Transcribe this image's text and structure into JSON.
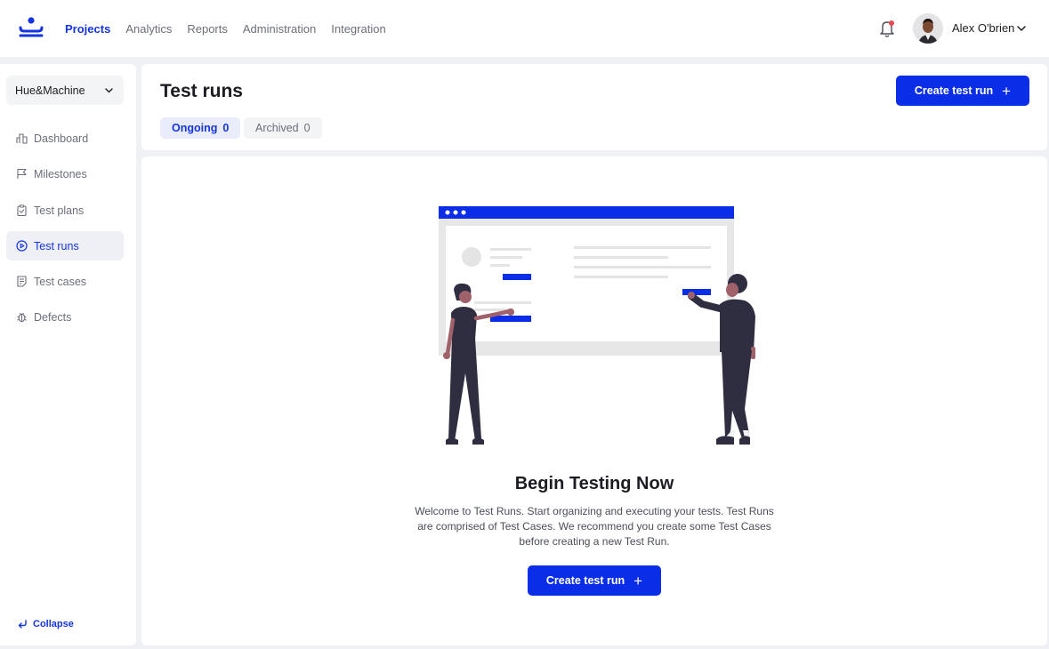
{
  "nav": {
    "items": [
      {
        "label": "Projects",
        "active": true
      },
      {
        "label": "Analytics",
        "active": false
      },
      {
        "label": "Reports",
        "active": false
      },
      {
        "label": "Administration",
        "active": false
      },
      {
        "label": "Integration",
        "active": false
      }
    ]
  },
  "user": {
    "name": "Alex O'brien",
    "has_notification": true
  },
  "sidebar": {
    "project": "Hue&Machine",
    "items": [
      {
        "label": "Dashboard",
        "icon": "dashboard-icon"
      },
      {
        "label": "Milestones",
        "icon": "flag-icon"
      },
      {
        "label": "Test plans",
        "icon": "clipboard-icon"
      },
      {
        "label": "Test runs",
        "icon": "play-circle-icon",
        "active": true
      },
      {
        "label": "Test cases",
        "icon": "document-icon"
      },
      {
        "label": "Defects",
        "icon": "bug-icon"
      }
    ],
    "collapse_label": "Collapse"
  },
  "header": {
    "title": "Test runs",
    "create_label": "Create test run",
    "tabs": [
      {
        "label": "Ongoing",
        "count": "0",
        "active": true
      },
      {
        "label": "Archived",
        "count": "0",
        "active": false
      }
    ]
  },
  "empty_state": {
    "title": "Begin Testing Now",
    "description": "Welcome to Test Runs. Start organizing and executing your tests. Test Runs are comprised of Test Cases. We recommend you create some Test Cases before creating a new Test Run.",
    "button_label": "Create test run"
  },
  "colors": {
    "accent": "#0a2ee8",
    "accent_text": "#1434e0",
    "notification_dot": "#e5484d"
  }
}
